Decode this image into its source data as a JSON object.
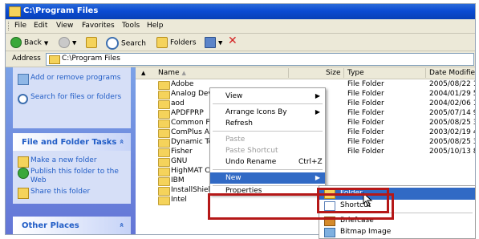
{
  "window": {
    "title": "C:\\Program Files"
  },
  "menu": [
    "File",
    "Edit",
    "View",
    "Favorites",
    "Tools",
    "Help"
  ],
  "toolbar": {
    "back": "Back",
    "search": "Search",
    "folders": "Folders"
  },
  "address": {
    "label": "Address",
    "value": "C:\\Program Files"
  },
  "tasks": {
    "system_items": [
      "Add or remove programs",
      "Search for files or folders"
    ],
    "file_folder_header": "File and Folder Tasks",
    "file_folder_items": [
      "Make a new folder",
      "Publish this folder to the Web",
      "Share this folder"
    ],
    "other_places_header": "Other Places",
    "collapse_glyph": "»"
  },
  "columns": {
    "name": "Name",
    "size": "Size",
    "type": "Type",
    "date": "Date Modified"
  },
  "files": [
    {
      "name": "Adobe",
      "type": "File Folder",
      "date": "2005/08/22 10:1"
    },
    {
      "name": "Analog Devices",
      "type": "File Folder",
      "date": "2004/01/29 5:33"
    },
    {
      "name": "aod",
      "type": "File Folder",
      "date": "2004/02/06 1:31"
    },
    {
      "name": "APDFPRP",
      "type": "File Folder",
      "date": "2005/07/14 9:40"
    },
    {
      "name": "Common Files",
      "type": "File Folder",
      "date": "2005/08/25 3:49"
    },
    {
      "name": "ComPlus Applications",
      "type": "File Folder",
      "date": "2003/02/19 4:24"
    },
    {
      "name": "Dynamic Toolbar",
      "type": "File Folder",
      "date": "2005/08/25 3:46"
    },
    {
      "name": "Fisher",
      "type": "File Folder",
      "date": "2005/10/13 8:56"
    },
    {
      "name": "GNU",
      "type": "",
      "date": ""
    },
    {
      "name": "HighMAT CD Writing Wizard",
      "type": "",
      "date": ""
    },
    {
      "name": "IBM",
      "type": "",
      "date": ""
    },
    {
      "name": "InstallShield Installation Infor…",
      "type": "",
      "date": ""
    },
    {
      "name": "Intel",
      "type": "",
      "date": ""
    }
  ],
  "context_menu": {
    "view": "View",
    "arrange": "Arrange Icons By",
    "refresh": "Refresh",
    "paste": "Paste",
    "paste_shortcut": "Paste Shortcut",
    "undo_rename": "Undo Rename",
    "undo_shortcut": "Ctrl+Z",
    "new": "New",
    "properties": "Properties"
  },
  "new_submenu": [
    "Folder",
    "Shortcut",
    "Briefcase",
    "Bitmap Image"
  ]
}
